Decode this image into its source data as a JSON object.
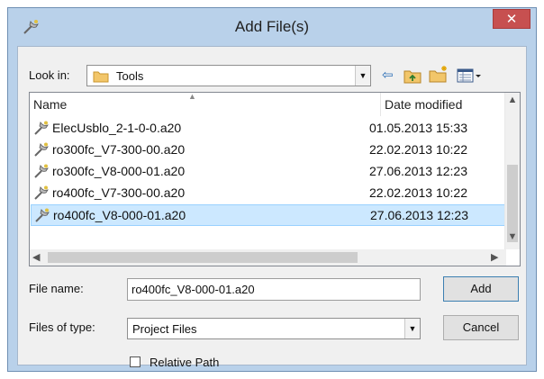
{
  "window": {
    "title": "Add File(s)",
    "close_glyph": "✕"
  },
  "toolbar": {
    "look_in_label": "Look in:",
    "look_in_value": "Tools",
    "icons": [
      "back-icon",
      "up-folder-icon",
      "new-folder-icon",
      "view-menu-icon"
    ]
  },
  "list": {
    "columns": {
      "name": "Name",
      "date": "Date modified"
    },
    "rows": [
      {
        "name": "ElecUsblo_2-1-0-0.a20",
        "date": "01.05.2013 15:33"
      },
      {
        "name": "ro300fc_V7-300-00.a20",
        "date": "22.02.2013 10:22"
      },
      {
        "name": "ro300fc_V8-000-01.a20",
        "date": "27.06.2013 12:23"
      },
      {
        "name": "ro400fc_V7-300-00.a20",
        "date": "22.02.2013 10:22"
      },
      {
        "name": "ro400fc_V8-000-01.a20",
        "date": "27.06.2013 12:23"
      }
    ],
    "selected_index": 4
  },
  "form": {
    "file_name_label": "File name:",
    "file_name_value": "ro400fc_V8-000-01.a20",
    "file_type_label": "Files of type:",
    "file_type_value": "Project Files",
    "relative_path_label": "Relative Path",
    "relative_path_checked": false
  },
  "buttons": {
    "add": "Add",
    "cancel": "Cancel"
  },
  "colors": {
    "selection": "#cce8ff",
    "frame": "#b9d1ea",
    "close": "#c75050"
  }
}
